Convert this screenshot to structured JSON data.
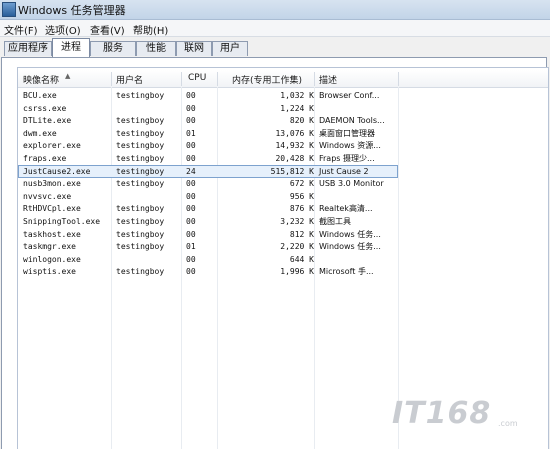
{
  "window": {
    "title": "Windows 任务管理器"
  },
  "menu": [
    "文件(F)",
    "选项(O)",
    "查看(V)",
    "帮助(H)"
  ],
  "tabs": [
    {
      "label": "应用程序"
    },
    {
      "label": "进程",
      "active": true
    },
    {
      "label": "服务"
    },
    {
      "label": "性能"
    },
    {
      "label": "联网"
    },
    {
      "label": "用户"
    }
  ],
  "columns": {
    "name": "映像名称",
    "user": "用户名",
    "cpu": "CPU",
    "mem": "内存(专用工作集)",
    "desc": "描述"
  },
  "processes": [
    {
      "name": "BCU.exe",
      "user": "testingboy",
      "cpu": "00",
      "mem": "1,032 K",
      "desc": "Browser Conf..."
    },
    {
      "name": "csrss.exe",
      "user": "",
      "cpu": "00",
      "mem": "1,224 K",
      "desc": ""
    },
    {
      "name": "DTLite.exe",
      "user": "testingboy",
      "cpu": "00",
      "mem": "820 K",
      "desc": "DAEMON Tools..."
    },
    {
      "name": "dwm.exe",
      "user": "testingboy",
      "cpu": "01",
      "mem": "13,076 K",
      "desc": "桌面窗口管理器"
    },
    {
      "name": "explorer.exe",
      "user": "testingboy",
      "cpu": "00",
      "mem": "14,932 K",
      "desc": "Windows 资源..."
    },
    {
      "name": "fraps.exe",
      "user": "testingboy",
      "cpu": "00",
      "mem": "20,428 K",
      "desc": "Fraps 摄理少..."
    },
    {
      "name": "JustCause2.exe",
      "user": "testingboy",
      "cpu": "24",
      "mem": "515,812 K",
      "desc": "Just Cause 2",
      "selected": true
    },
    {
      "name": "nusb3mon.exe",
      "user": "testingboy",
      "cpu": "00",
      "mem": "672 K",
      "desc": "USB 3.0 Monitor"
    },
    {
      "name": "nvvsvc.exe",
      "user": "",
      "cpu": "00",
      "mem": "956 K",
      "desc": ""
    },
    {
      "name": "RtHDVCpl.exe",
      "user": "testingboy",
      "cpu": "00",
      "mem": "876 K",
      "desc": "Realtek高清..."
    },
    {
      "name": "SnippingTool.exe",
      "user": "testingboy",
      "cpu": "00",
      "mem": "3,232 K",
      "desc": "截图工具"
    },
    {
      "name": "taskhost.exe",
      "user": "testingboy",
      "cpu": "00",
      "mem": "812 K",
      "desc": "Windows 任务..."
    },
    {
      "name": "taskmgr.exe",
      "user": "testingboy",
      "cpu": "01",
      "mem": "2,220 K",
      "desc": "Windows 任务..."
    },
    {
      "name": "winlogon.exe",
      "user": "",
      "cpu": "00",
      "mem": "644 K",
      "desc": ""
    },
    {
      "name": "wisptis.exe",
      "user": "testingboy",
      "cpu": "00",
      "mem": "1,996 K",
      "desc": "Microsoft 手..."
    }
  ],
  "watermark": {
    "logo": "IT168",
    "suffix": ".com"
  }
}
